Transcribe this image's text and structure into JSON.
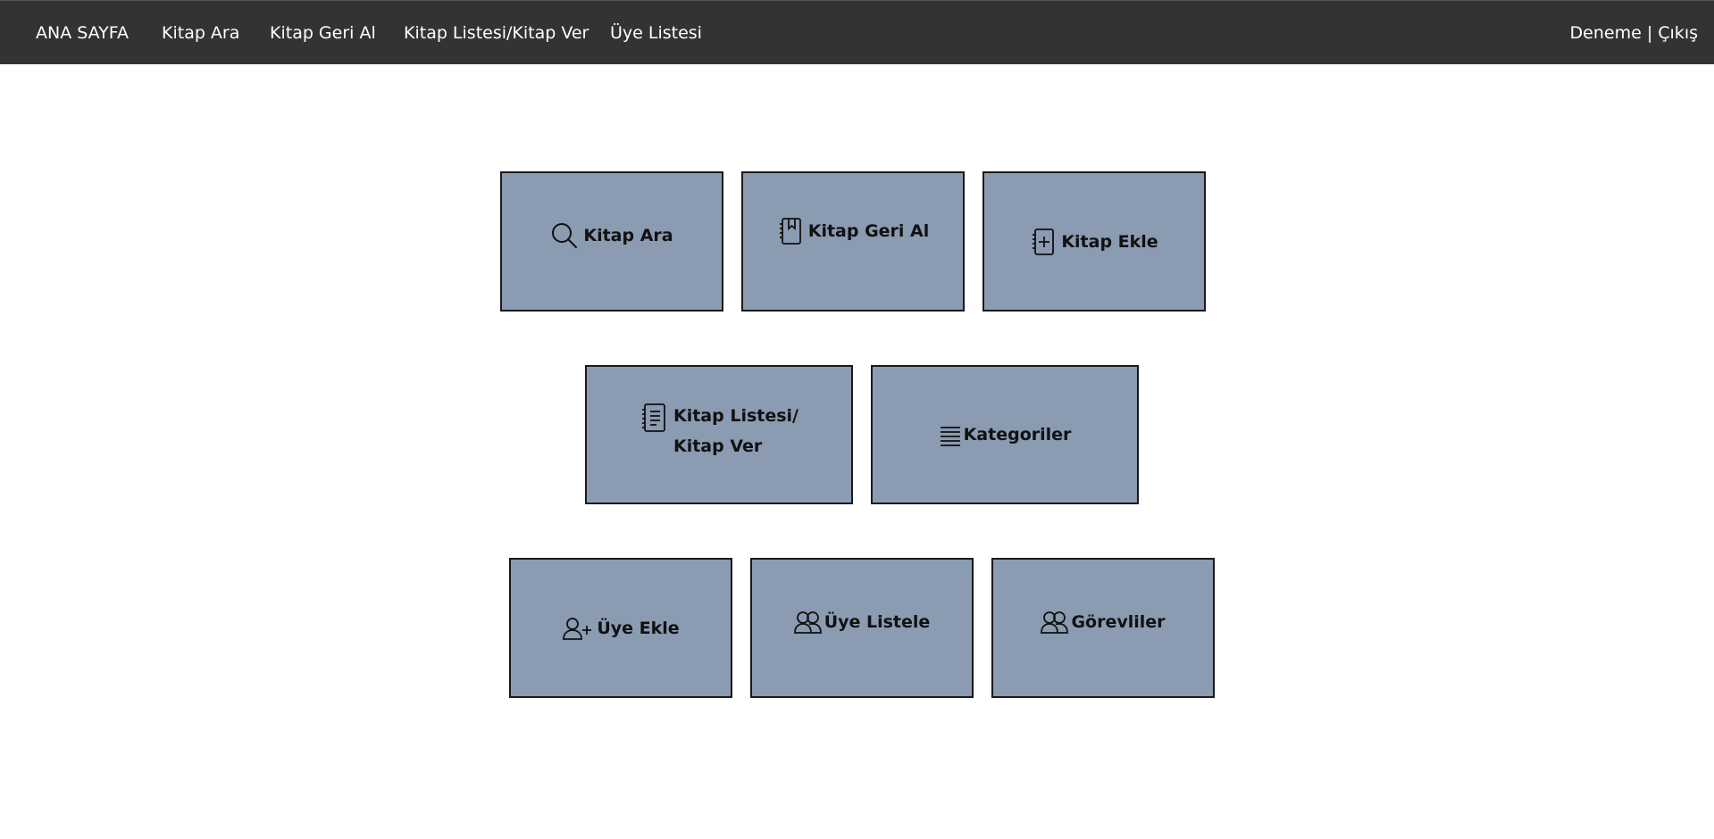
{
  "nav": {
    "home": "ANA SAYFA",
    "search": "Kitap Ara",
    "return": "Kitap Geri Al",
    "list": "Kitap Listesi/Kitap Ver",
    "members": "Üye Listesi",
    "user_name": "Deneme",
    "separator": " | ",
    "logout": "Çıkış"
  },
  "tiles": {
    "kitap_ara": {
      "label": "Kitap Ara",
      "icon": "search-icon"
    },
    "kitap_geri_al": {
      "label": "Kitap Geri Al",
      "icon": "bookmark-book-icon"
    },
    "kitap_ekle": {
      "label": "Kitap Ekle",
      "icon": "add-book-icon"
    },
    "kitap_listesi": {
      "label_line1": "Kitap Listesi/",
      "label_line2": "Kitap Ver",
      "icon": "list-book-icon"
    },
    "kategoriler": {
      "label": "Kategoriler",
      "icon": "list-icon"
    },
    "uye_ekle": {
      "label": "Üye Ekle",
      "icon": "user-add-icon"
    },
    "uye_listele": {
      "label": "Üye Listele",
      "icon": "users-icon"
    },
    "gorevliler": {
      "label": "Görevliler",
      "icon": "users-icon"
    }
  },
  "colors": {
    "navbar": "#333333",
    "tile": "#8a9bb2",
    "tile_border": "#1a1a1a"
  }
}
